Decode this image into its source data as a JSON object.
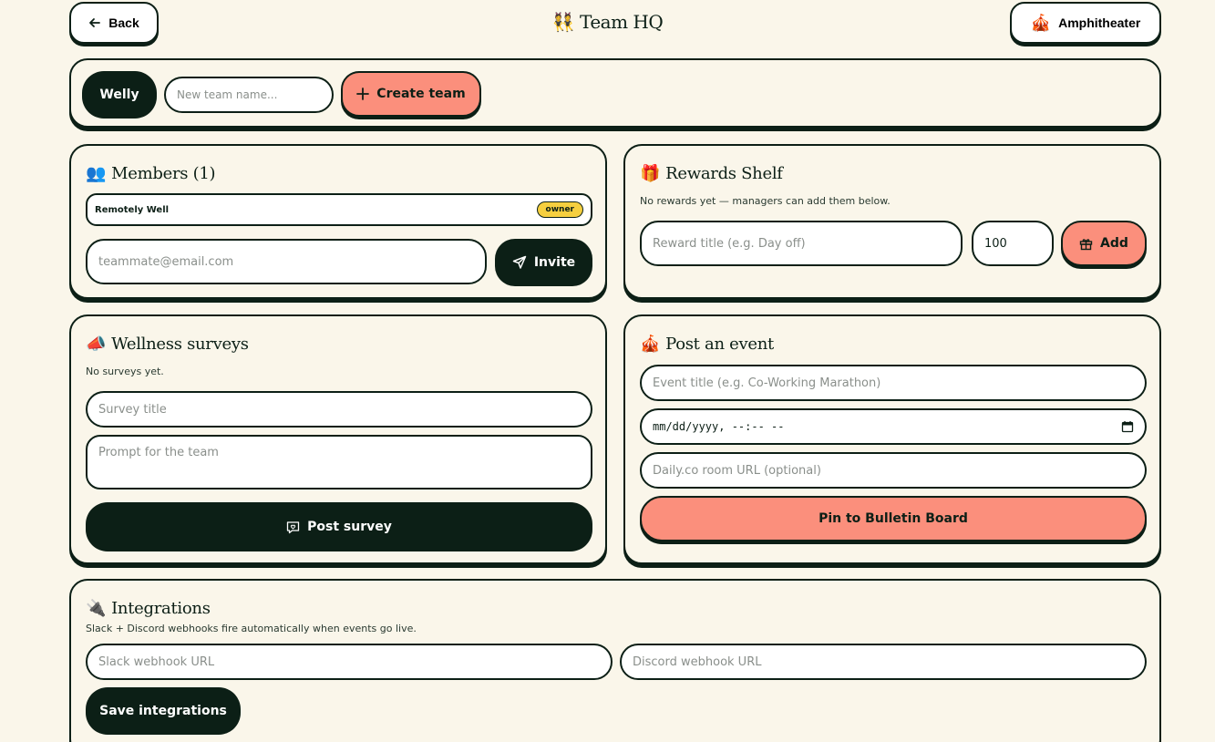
{
  "header": {
    "back_label": "Back",
    "title": "👯 Team HQ",
    "amphitheater_label": "Amphitheater",
    "amphitheater_emoji": "🎪"
  },
  "teams": {
    "active_team": "Welly",
    "new_team_placeholder": "New team name...",
    "create_label": "Create team"
  },
  "members": {
    "emoji": "👥",
    "title": "Members (1)",
    "list": [
      {
        "name": "Remotely Well",
        "role": "owner"
      }
    ],
    "invite_placeholder": "teammate@email.com",
    "invite_label": "Invite"
  },
  "rewards": {
    "emoji": "🎁",
    "title": "Rewards Shelf",
    "note": "No rewards yet — managers can add them below.",
    "title_placeholder": "Reward title (e.g. Day off)",
    "points_value": "100",
    "add_label": "Add"
  },
  "surveys": {
    "emoji": "📣",
    "title": "Wellness surveys",
    "note": "No surveys yet.",
    "title_placeholder": "Survey title",
    "prompt_placeholder": "Prompt for the team",
    "post_label": "Post survey"
  },
  "event": {
    "emoji": "🎪",
    "title": "Post an event",
    "title_placeholder": "Event title (e.g. Co-Working Marathon)",
    "datetime_placeholder": "mm/dd/yyyy, --:-- --",
    "room_placeholder": "Daily.co room URL (optional)",
    "pin_label": "Pin to Bulletin Board"
  },
  "integrations": {
    "emoji": "🔌",
    "title": "Integrations",
    "note": "Slack + Discord webhooks fire automatically when events go live.",
    "slack_placeholder": "Slack webhook URL",
    "discord_placeholder": "Discord webhook URL",
    "save_label": "Save integrations"
  },
  "colors": {
    "background": "#faf6ea",
    "ink": "#0c1f16",
    "coral": "#fb8f7c",
    "badge_yellow": "#f6cf3f"
  }
}
